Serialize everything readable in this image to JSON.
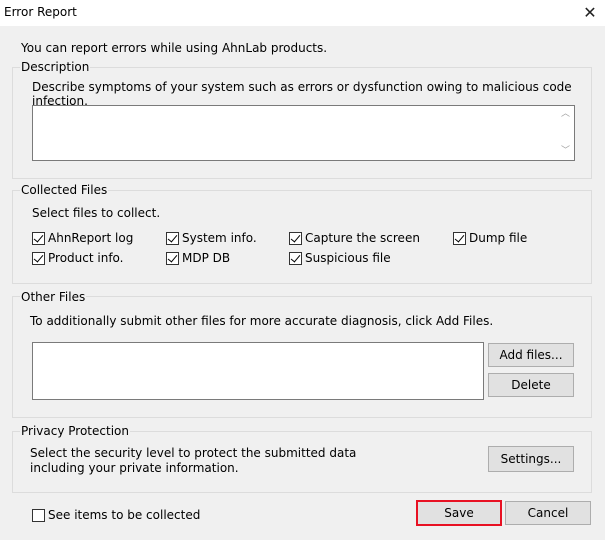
{
  "window": {
    "title": "Error Report",
    "close_icon": "close-icon"
  },
  "intro": "You can report errors while using AhnLab products.",
  "description": {
    "title": "Description",
    "hint": "Describe symptoms of your system such as errors or dysfunction owing to malicious code infection.",
    "value": ""
  },
  "collected": {
    "title": "Collected Files",
    "hint": "Select files to collect.",
    "items": [
      {
        "label": "AhnReport log",
        "checked": true
      },
      {
        "label": "System info.",
        "checked": true
      },
      {
        "label": "Capture the screen",
        "checked": true
      },
      {
        "label": "Dump file",
        "checked": true
      },
      {
        "label": "Product info.",
        "checked": true
      },
      {
        "label": "MDP DB",
        "checked": true
      },
      {
        "label": "Suspicious file",
        "checked": true
      }
    ]
  },
  "other": {
    "title": "Other Files",
    "hint": "To additionally submit other files for more accurate diagnosis, click Add Files.",
    "add_label": "Add files...",
    "delete_label": "Delete"
  },
  "privacy": {
    "title": "Privacy Protection",
    "line1": "Select the security level to protect the submitted data",
    "line2": "including your private information.",
    "settings_label": "Settings..."
  },
  "footer": {
    "see_items_label": "See items to be collected",
    "see_items_checked": false,
    "save_label": "Save",
    "cancel_label": "Cancel",
    "accent": "#e81123"
  }
}
